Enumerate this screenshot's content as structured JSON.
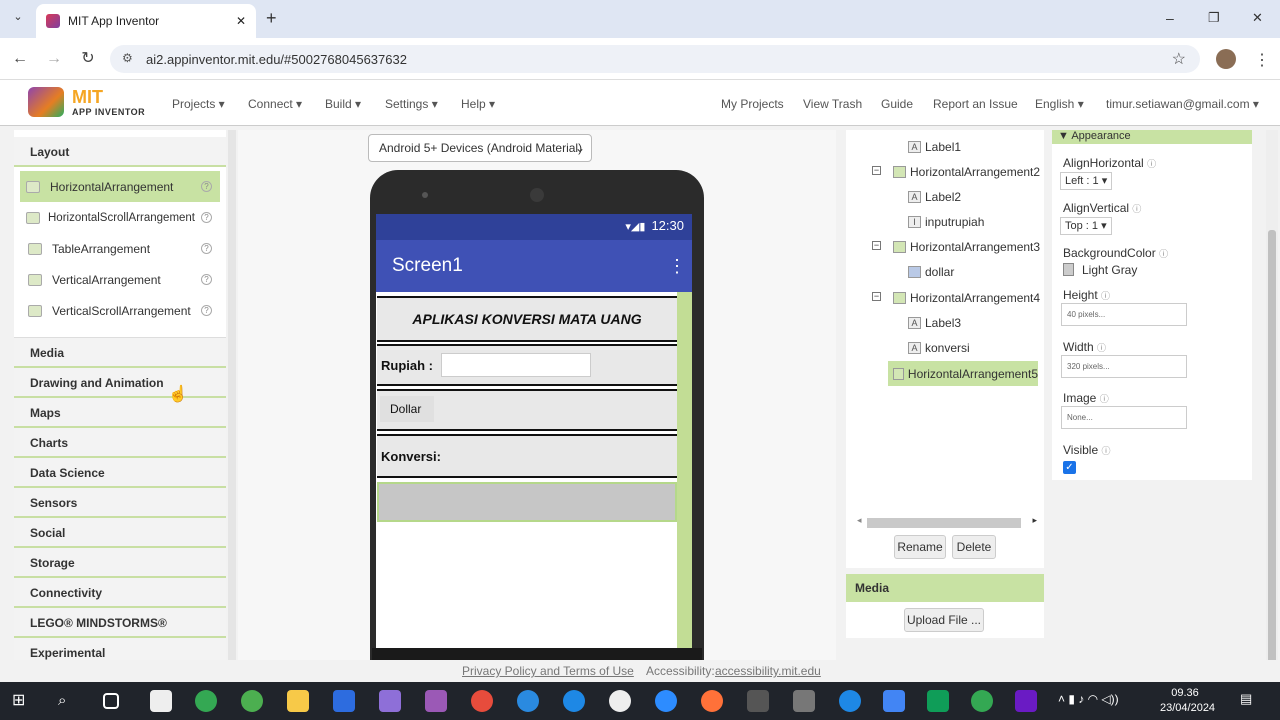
{
  "browser": {
    "tab_title": "MIT App Inventor",
    "new_tab": "+",
    "url": "ai2.appinventor.mit.edu/#5002768045637632",
    "window_controls": [
      "–",
      "❐",
      "✕"
    ]
  },
  "header": {
    "logo_top": "MIT",
    "logo_bottom": "APP INVENTOR",
    "menus": [
      "Projects ▾",
      "Connect ▾",
      "Build ▾",
      "Settings ▾",
      "Help ▾"
    ],
    "right_links": [
      "My Projects",
      "View Trash",
      "Guide",
      "Report an Issue",
      "English ▾",
      "timur.setiawan@gmail.com ▾"
    ]
  },
  "palette": {
    "layout_title": "Layout",
    "layout_items": [
      "HorizontalArrangement",
      "HorizontalScrollArrangement",
      "TableArrangement",
      "VerticalArrangement",
      "VerticalScrollArrangement"
    ],
    "categories": [
      "Media",
      "Drawing and Animation",
      "Maps",
      "Charts",
      "Data Science",
      "Sensors",
      "Social",
      "Storage",
      "Connectivity",
      "LEGO® MINDSTORMS®",
      "Experimental"
    ]
  },
  "viewer": {
    "device_select": "Android 5+ Devices (Android Material)",
    "status_time": "12:30",
    "screen_title": "Screen1",
    "app_title": "APLIKASI KONVERSI MATA UANG",
    "rupiah_label": "Rupiah :",
    "dollar_button": "Dollar",
    "konversi_label": "Konversi:"
  },
  "components": {
    "nodes": [
      "Label1",
      "HorizontalArrangement2",
      "Label2",
      "inputrupiah",
      "HorizontalArrangement3",
      "dollar",
      "HorizontalArrangement4",
      "Label3",
      "konversi",
      "HorizontalArrangement5"
    ],
    "rename": "Rename",
    "delete": "Delete",
    "media_title": "Media",
    "upload": "Upload File ..."
  },
  "properties": {
    "section": "Appearance",
    "align_h_label": "AlignHorizontal",
    "align_h_value": "Left : 1 ▾",
    "align_v_label": "AlignVertical",
    "align_v_value": "Top : 1 ▾",
    "bg_label": "BackgroundColor",
    "bg_value": "Light Gray",
    "height_label": "Height",
    "height_value": "40 pixels...",
    "width_label": "Width",
    "width_value": "320 pixels...",
    "image_label": "Image",
    "image_value": "None...",
    "visible_label": "Visible"
  },
  "footer": {
    "privacy": "Privacy Policy and Terms of Use",
    "accessibility_label": "Accessibility:",
    "accessibility_link": "accessibility.mit.edu"
  },
  "taskbar": {
    "time": "09.36",
    "date": "23/04/2024"
  },
  "colors": {
    "accent_green": "#c8e2a3",
    "app_bar": "#3f51b5",
    "status_bar": "#2f4199"
  }
}
